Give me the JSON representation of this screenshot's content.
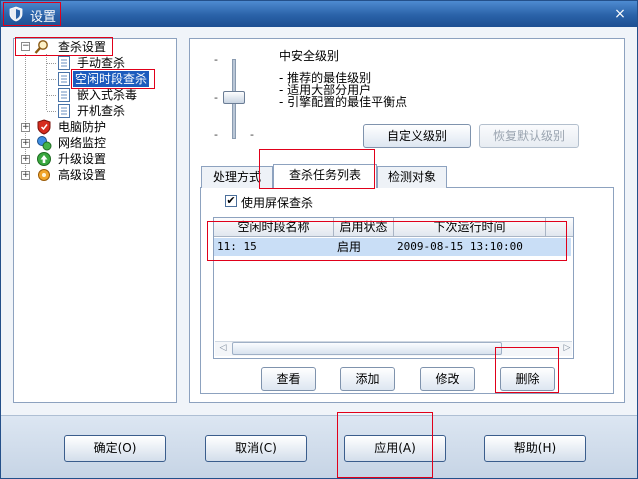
{
  "window": {
    "title": "设置",
    "close_glyph": "×"
  },
  "tree": {
    "root": {
      "label": "查杀设置",
      "icon": "magnifier-scan-icon"
    },
    "children": [
      {
        "label": "手动查杀"
      },
      {
        "label": "空闲时段查杀",
        "selected": true
      },
      {
        "label": "嵌入式杀毒"
      },
      {
        "label": "开机查杀"
      }
    ],
    "others": [
      {
        "label": "电脑防护",
        "icon": "shield-icon"
      },
      {
        "label": "网络监控",
        "icon": "network-icon"
      },
      {
        "label": "升级设置",
        "icon": "update-icon"
      },
      {
        "label": "高级设置",
        "icon": "advanced-icon"
      }
    ]
  },
  "level": {
    "title": "中安全级别",
    "descriptions": [
      "- 推荐的最佳级别",
      "- 适用大部分用户",
      "- 引擎配置的最佳平衡点"
    ],
    "ticks": [
      "-",
      "-",
      "-",
      "-"
    ],
    "custom_button": "自定义级别",
    "restore_button": "恢复默认级别"
  },
  "tabs": [
    "处理方式",
    "查杀任务列表",
    "检测对象"
  ],
  "active_tab": "查杀任务列表",
  "screensaver": {
    "checked": true,
    "check_glyph": "✔",
    "label": "使用屏保查杀"
  },
  "task_list": {
    "columns": [
      "空闲时段名称",
      "启用状态",
      "下次运行时间"
    ],
    "rows": [
      {
        "name": "11: 15",
        "status": "启用",
        "next_run": "2009-08-15 13:10:00"
      }
    ],
    "scroll_left": "◁",
    "scroll_right": "▷"
  },
  "list_buttons": {
    "view": "查看",
    "add": "添加",
    "edit": "修改",
    "delete": "删除"
  },
  "footer": {
    "ok": "确定(O)",
    "cancel": "取消(C)",
    "apply": "应用(A)",
    "help": "帮助(H)"
  }
}
